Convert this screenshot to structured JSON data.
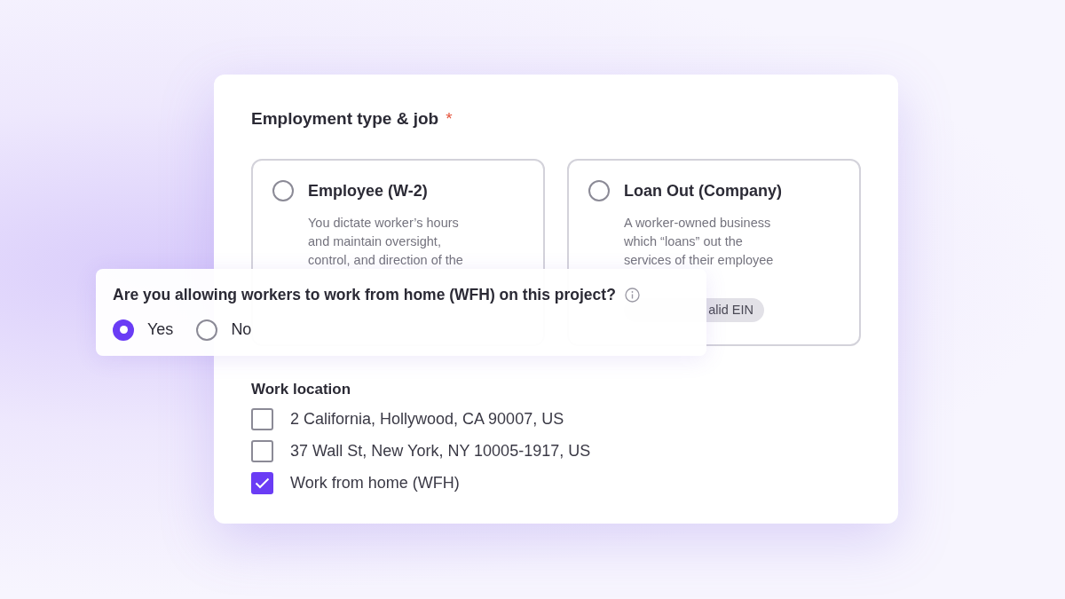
{
  "section": {
    "title": "Employment type & job",
    "required_mark": "*"
  },
  "employment_options": [
    {
      "title": "Employee (W-2)",
      "selected": false,
      "description_lines": [
        "You dictate worker’s hours",
        "and maintain oversight,",
        "control, and direction of the"
      ]
    },
    {
      "title": "Loan Out (Company)",
      "selected": false,
      "description_lines": [
        "A worker-owned business",
        "which “loans” out the",
        "services of their employee"
      ],
      "badge": "alid EIN"
    }
  ],
  "wfh_question": {
    "label": "Are you allowing workers to work from home (WFH) on this project?",
    "options": [
      {
        "label": "Yes",
        "selected": true
      },
      {
        "label": "No",
        "selected": false
      }
    ]
  },
  "work_location": {
    "label": "Work location",
    "options": [
      {
        "label": "2 California, Hollywood, CA 90007, US",
        "checked": false
      },
      {
        "label": "37 Wall St, New York, NY 10005-1917, US",
        "checked": false
      },
      {
        "label": "Work from home (WFH)",
        "checked": true
      }
    ]
  }
}
